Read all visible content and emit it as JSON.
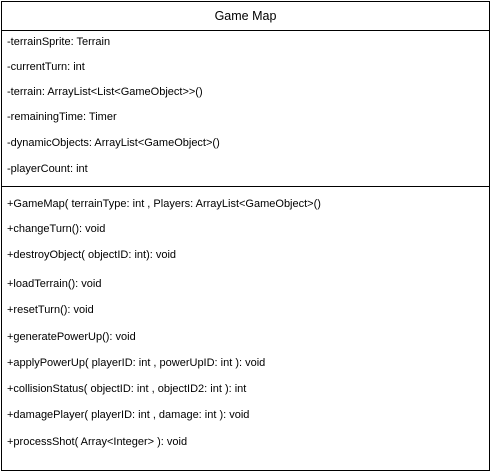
{
  "class_name": "Game Map",
  "attributes": [
    "-terrainSprite: Terrain",
    "-currentTurn: int",
    "-terrain: ArrayList<List<GameObject>>()",
    "-remainingTime: Timer",
    "-dynamicObjects: ArrayList<GameObject>()",
    "-playerCount: int"
  ],
  "methods": [
    "+GameMap( terrainType: int , Players:  ArrayList<GameObject>()",
    "+changeTurn(): void",
    "+destroyObject( objectID: int): void",
    "+loadTerrain(): void",
    "+resetTurn(): void",
    "+generatePowerUp(): void",
    "+applyPowerUp( playerID: int , powerUpID: int ): void",
    "+collisionStatus( objectID: int , objectID2: int ): int",
    "+damagePlayer( playerID: int , damage: int ): void",
    "+processShot( Array<Integer> ): void"
  ]
}
